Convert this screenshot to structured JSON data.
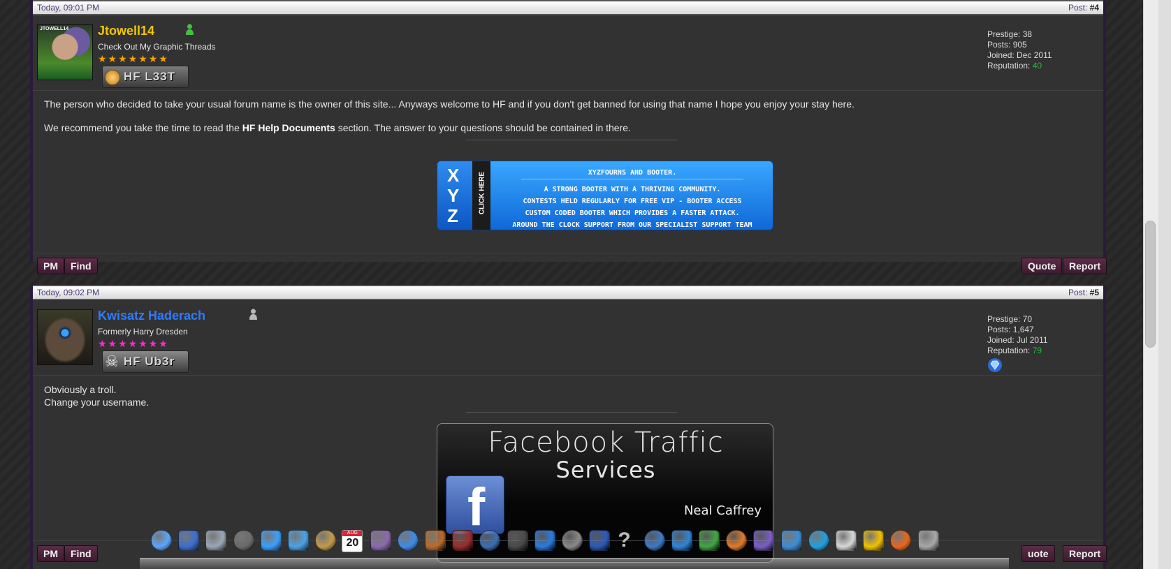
{
  "posts": [
    {
      "timestamp": "Today, 09:01 PM",
      "post_label": "Post:",
      "post_number": "#4",
      "username": "Jtowell14",
      "username_color": "#f2c500",
      "user_title": "Check Out My Graphic Threads",
      "stars": "★★★★★★★",
      "star_color": "#f5a300",
      "userbar_text": "HF L33T",
      "avatar_text": "JTOWELL14",
      "stats": {
        "prestige_label": "Prestige:",
        "prestige": "38",
        "posts_label": "Posts:",
        "posts": "905",
        "joined_label": "Joined:",
        "joined": "Dec 2011",
        "reputation_label": "Reputation:",
        "reputation": "40"
      },
      "body_line1": "The person who decided to take your usual forum name is the owner of this site... Anyways welcome to HF and if you don't get banned for using that name I hope you enjoy your stay here.",
      "body_line2_pre": "We recommend you take the time to read the",
      "body_line2_link": "HF Help Documents",
      "body_line2_post": "section. The answer to your questions should be contained in there.",
      "banner": {
        "logo_text": "XYZ",
        "click_text": "CLICK HERE",
        "title": "XYZFOURNS AND BOOTER.",
        "lines": [
          "A STRONG BOOTER WITH A THRIVING COMMUNITY.",
          "CONTESTS HELD REGULARLY FOR FREE VIP - BOOTER ACCESS",
          "CUSTOM CODED BOOTER WHICH PROVIDES A FASTER ATTACK.",
          "AROUND THE CLOCK SUPPORT FROM OUR SPECIALIST SUPPORT TEAM"
        ]
      },
      "buttons": {
        "pm": "PM",
        "find": "Find",
        "quote": "Quote",
        "report": "Report"
      }
    },
    {
      "timestamp": "Today, 09:02 PM",
      "post_label": "Post:",
      "post_number": "#5",
      "username": "Kwisatz Haderach",
      "username_color": "#2f7bff",
      "user_title": "Formerly Harry Dresden",
      "stars": "★★★★★★★",
      "star_color": "#ff2bd0",
      "userbar_text": "HF Ub3r",
      "stats": {
        "prestige_label": "Prestige:",
        "prestige": "70",
        "posts_label": "Posts:",
        "posts": "1,647",
        "joined_label": "Joined:",
        "joined": "Jul 2011",
        "reputation_label": "Reputation:",
        "reputation": "79"
      },
      "body_line1": "Obviously a troll.",
      "body_line2": "Change your username.",
      "banner": {
        "title_line1": "Facebook Traffic",
        "title_line2": "Services",
        "logo_letter": "f",
        "author": "Neal Caffrey"
      },
      "buttons": {
        "pm": "PM",
        "find": "Find",
        "quote": "uote",
        "report": "Report"
      }
    }
  ],
  "dock": {
    "icons": [
      "finder-icon",
      "textedit-pen-icon",
      "mail-stamp-icon",
      "dashboard-icon",
      "safari-icon",
      "facetime-icon",
      "address-book-icon",
      "calendar-icon",
      "preview-icon",
      "itunes-icon",
      "garageband-icon",
      "dictionary-icon",
      "spaces-icon",
      "time-machine-icon",
      "google-earth-icon",
      "system-preferences-icon",
      "dvd-player-icon",
      "help-icon",
      "iphoto-icon",
      "word-icon",
      "excel-icon",
      "powerpoint-icon",
      "entourage-icon",
      "office-icon",
      "skype-icon",
      "script-icon",
      "aim-icon",
      "firefox-icon",
      "trash-icon"
    ],
    "calendar_day": "20",
    "calendar_month": "AUG"
  }
}
